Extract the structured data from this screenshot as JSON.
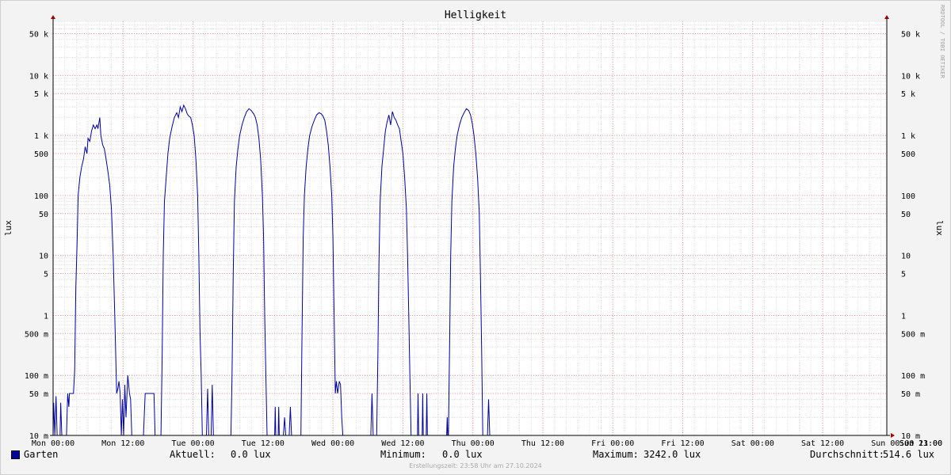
{
  "chart_data": {
    "type": "line",
    "title": "Helligkeit",
    "ylabel": "lux",
    "watermark": "RRDTOOL / TOBI OETIKER",
    "y_scale": "log",
    "ylim": [
      0.01,
      80000
    ],
    "y_ticks": [
      {
        "value": 0.01,
        "label": "10 m"
      },
      {
        "value": 0.05,
        "label": "50 m"
      },
      {
        "value": 0.1,
        "label": "100 m"
      },
      {
        "value": 0.5,
        "label": "500 m"
      },
      {
        "value": 1,
        "label": "1"
      },
      {
        "value": 5,
        "label": "5"
      },
      {
        "value": 10,
        "label": "10"
      },
      {
        "value": 50,
        "label": "50"
      },
      {
        "value": 100,
        "label": "100"
      },
      {
        "value": 500,
        "label": "500"
      },
      {
        "value": 1000,
        "label": "1 k"
      },
      {
        "value": 5000,
        "label": "5 k"
      },
      {
        "value": 10000,
        "label": "10 k"
      },
      {
        "value": 50000,
        "label": "50 k"
      }
    ],
    "x_range_hours": [
      0,
      143
    ],
    "x_ticks": [
      {
        "hour": 0,
        "label": "Mon 00:00"
      },
      {
        "hour": 12,
        "label": "Mon 12:00"
      },
      {
        "hour": 24,
        "label": "Tue 00:00"
      },
      {
        "hour": 36,
        "label": "Tue 12:00"
      },
      {
        "hour": 48,
        "label": "Wed 00:00"
      },
      {
        "hour": 60,
        "label": "Wed 12:00"
      },
      {
        "hour": 72,
        "label": "Thu 00:00"
      },
      {
        "hour": 84,
        "label": "Thu 12:00"
      },
      {
        "hour": 96,
        "label": "Fri 00:00"
      },
      {
        "hour": 108,
        "label": "Fri 12:00"
      },
      {
        "hour": 120,
        "label": "Sat 00:00"
      },
      {
        "hour": 132,
        "label": "Sat 12:00"
      },
      {
        "hour": 144,
        "label": "Sun 00:00"
      },
      {
        "hour": 155,
        "label": "Sun 11:00"
      },
      {
        "hour": 167,
        "label": "Sun 23:00"
      }
    ],
    "series": [
      {
        "name": "Garten",
        "color": "#0000a0",
        "points": [
          [
            0.0,
            0.01
          ],
          [
            0.1,
            0.035
          ],
          [
            0.3,
            0.01
          ],
          [
            0.5,
            0.045
          ],
          [
            0.7,
            0.01
          ],
          [
            1.2,
            0.01
          ],
          [
            1.3,
            0.035
          ],
          [
            1.5,
            0.01
          ],
          [
            2.3,
            0.01
          ],
          [
            2.5,
            0.05
          ],
          [
            2.7,
            0.03
          ],
          [
            2.8,
            0.05
          ],
          [
            3.2,
            0.05
          ],
          [
            3.5,
            0.05
          ],
          [
            3.7,
            0.12
          ],
          [
            3.9,
            3
          ],
          [
            4.1,
            15
          ],
          [
            4.3,
            100
          ],
          [
            4.6,
            200
          ],
          [
            4.9,
            300
          ],
          [
            5.2,
            400
          ],
          [
            5.5,
            650
          ],
          [
            5.8,
            500
          ],
          [
            6.0,
            900
          ],
          [
            6.3,
            800
          ],
          [
            6.6,
            1200
          ],
          [
            6.9,
            1500
          ],
          [
            7.2,
            1300
          ],
          [
            7.5,
            1500
          ],
          [
            7.7,
            1300
          ],
          [
            8.0,
            2000
          ],
          [
            8.2,
            1000
          ],
          [
            8.5,
            700
          ],
          [
            8.8,
            600
          ],
          [
            9.1,
            400
          ],
          [
            9.4,
            250
          ],
          [
            9.7,
            150
          ],
          [
            10.0,
            60
          ],
          [
            10.3,
            10
          ],
          [
            10.6,
            0.8
          ],
          [
            10.9,
            0.05
          ],
          [
            11.1,
            0.06
          ],
          [
            11.3,
            0.08
          ],
          [
            11.5,
            0.05
          ],
          [
            11.7,
            0.01
          ],
          [
            11.9,
            0.04
          ],
          [
            12.1,
            0.01
          ],
          [
            12.3,
            0.07
          ],
          [
            12.5,
            0.02
          ],
          [
            12.8,
            0.1
          ],
          [
            13.1,
            0.05
          ],
          [
            13.3,
            0.04
          ],
          [
            13.5,
            0.01
          ],
          [
            15.5,
            0.01
          ],
          [
            15.8,
            0.05
          ],
          [
            16.2,
            0.05
          ],
          [
            16.8,
            0.05
          ],
          [
            17.3,
            0.05
          ],
          [
            17.5,
            0.01
          ],
          [
            18.5,
            0.01
          ],
          [
            18.7,
            0.2
          ],
          [
            18.9,
            10
          ],
          [
            19.1,
            80
          ],
          [
            19.4,
            200
          ],
          [
            19.7,
            500
          ],
          [
            20.0,
            900
          ],
          [
            20.4,
            1400
          ],
          [
            20.8,
            2000
          ],
          [
            21.2,
            2400
          ],
          [
            21.5,
            2000
          ],
          [
            21.8,
            3000
          ],
          [
            22.1,
            2500
          ],
          [
            22.4,
            3200
          ],
          [
            22.7,
            2800
          ],
          [
            23.0,
            2300
          ],
          [
            23.3,
            2100
          ],
          [
            23.6,
            2000
          ],
          [
            23.9,
            1500
          ],
          [
            24.2,
            1000
          ],
          [
            24.5,
            400
          ],
          [
            24.8,
            100
          ],
          [
            25.0,
            10
          ],
          [
            25.2,
            0.5
          ],
          [
            25.4,
            0.1
          ],
          [
            25.6,
            0.01
          ],
          [
            26.3,
            0.01
          ],
          [
            26.5,
            0.06
          ],
          [
            26.7,
            0.01
          ],
          [
            27.1,
            0.01
          ],
          [
            27.3,
            0.07
          ],
          [
            27.5,
            0.01
          ],
          [
            28.0,
            0.01
          ],
          [
            30.5,
            0.01
          ],
          [
            30.7,
            0.1
          ],
          [
            30.9,
            5
          ],
          [
            31.1,
            80
          ],
          [
            31.4,
            300
          ],
          [
            31.7,
            600
          ],
          [
            32.0,
            1000
          ],
          [
            32.4,
            1500
          ],
          [
            32.8,
            2000
          ],
          [
            33.2,
            2500
          ],
          [
            33.6,
            2800
          ],
          [
            34.0,
            2600
          ],
          [
            34.4,
            2300
          ],
          [
            34.7,
            2000
          ],
          [
            35.0,
            1500
          ],
          [
            35.3,
            900
          ],
          [
            35.6,
            400
          ],
          [
            35.9,
            100
          ],
          [
            36.1,
            20
          ],
          [
            36.3,
            1
          ],
          [
            36.5,
            0.1
          ],
          [
            36.7,
            0.01
          ],
          [
            38.0,
            0.01
          ],
          [
            38.1,
            0.03
          ],
          [
            38.2,
            0.01
          ],
          [
            38.6,
            0.01
          ],
          [
            38.7,
            0.03
          ],
          [
            38.8,
            0.01
          ],
          [
            39.5,
            0.01
          ],
          [
            39.7,
            0.02
          ],
          [
            39.9,
            0.01
          ],
          [
            40.5,
            0.01
          ],
          [
            40.7,
            0.03
          ],
          [
            40.9,
            0.01
          ],
          [
            42.5,
            0.01
          ],
          [
            42.7,
            0.5
          ],
          [
            42.9,
            20
          ],
          [
            43.1,
            100
          ],
          [
            43.4,
            300
          ],
          [
            43.7,
            600
          ],
          [
            44.0,
            1000
          ],
          [
            44.4,
            1400
          ],
          [
            44.8,
            1800
          ],
          [
            45.2,
            2200
          ],
          [
            45.6,
            2400
          ],
          [
            46.0,
            2300
          ],
          [
            46.3,
            2100
          ],
          [
            46.6,
            1800
          ],
          [
            46.9,
            1200
          ],
          [
            47.2,
            700
          ],
          [
            47.5,
            300
          ],
          [
            47.8,
            100
          ],
          [
            48.0,
            20
          ],
          [
            48.2,
            1
          ],
          [
            48.4,
            0.05
          ],
          [
            48.6,
            0.08
          ],
          [
            48.8,
            0.05
          ],
          [
            49.1,
            0.08
          ],
          [
            49.3,
            0.07
          ],
          [
            49.5,
            0.02
          ],
          [
            49.7,
            0.01
          ],
          [
            54.5,
            0.01
          ],
          [
            54.7,
            0.05
          ],
          [
            54.9,
            0.01
          ],
          [
            55.0,
            0.01
          ],
          [
            55.5,
            0.01
          ],
          [
            55.7,
            0.2
          ],
          [
            55.9,
            8
          ],
          [
            56.1,
            80
          ],
          [
            56.4,
            300
          ],
          [
            56.7,
            600
          ],
          [
            57.0,
            1200
          ],
          [
            57.3,
            1700
          ],
          [
            57.6,
            2200
          ],
          [
            57.9,
            1500
          ],
          [
            58.2,
            2500
          ],
          [
            58.5,
            2000
          ],
          [
            58.8,
            1800
          ],
          [
            59.1,
            1500
          ],
          [
            59.4,
            1300
          ],
          [
            59.7,
            800
          ],
          [
            60.0,
            500
          ],
          [
            60.3,
            200
          ],
          [
            60.6,
            60
          ],
          [
            60.8,
            10
          ],
          [
            61.0,
            1
          ],
          [
            61.2,
            0.1
          ],
          [
            61.4,
            0.01
          ],
          [
            62.5,
            0.01
          ],
          [
            62.6,
            0.05
          ],
          [
            62.7,
            0.01
          ],
          [
            63.3,
            0.01
          ],
          [
            63.4,
            0.05
          ],
          [
            63.5,
            0.01
          ],
          [
            64.0,
            0.01
          ],
          [
            64.1,
            0.05
          ],
          [
            64.2,
            0.01
          ],
          [
            65.0,
            0.01
          ],
          [
            67.5,
            0.01
          ],
          [
            67.6,
            0.02
          ],
          [
            67.7,
            0.01
          ],
          [
            67.8,
            0.01
          ],
          [
            68.0,
            0.3
          ],
          [
            68.2,
            10
          ],
          [
            68.4,
            80
          ],
          [
            68.7,
            300
          ],
          [
            69.0,
            600
          ],
          [
            69.3,
            1000
          ],
          [
            69.7,
            1500
          ],
          [
            70.1,
            2000
          ],
          [
            70.5,
            2400
          ],
          [
            70.9,
            2800
          ],
          [
            71.3,
            2600
          ],
          [
            71.6,
            2200
          ],
          [
            71.9,
            1600
          ],
          [
            72.2,
            1000
          ],
          [
            72.5,
            500
          ],
          [
            72.8,
            200
          ],
          [
            73.1,
            50
          ],
          [
            73.3,
            5
          ],
          [
            73.5,
            0.3
          ],
          [
            73.7,
            0.01
          ],
          [
            74.5,
            0.01
          ],
          [
            74.7,
            0.04
          ],
          [
            74.9,
            0.01
          ]
        ]
      }
    ],
    "legend": "bottom-left"
  },
  "footer": {
    "legend_label": "Garten",
    "aktuell_label": "Aktuell:",
    "aktuell_value": "0.0 lux",
    "minimum_label": "Minimum:",
    "minimum_value": "0.0 lux",
    "maximum_label": "Maximum:",
    "maximum_value": "3242.0 lux",
    "average_label": "Durchschnitt:",
    "average_value": "514.6 lux",
    "credit": "Erstellungszeit: 23:58 Uhr am 27.10.2024"
  }
}
